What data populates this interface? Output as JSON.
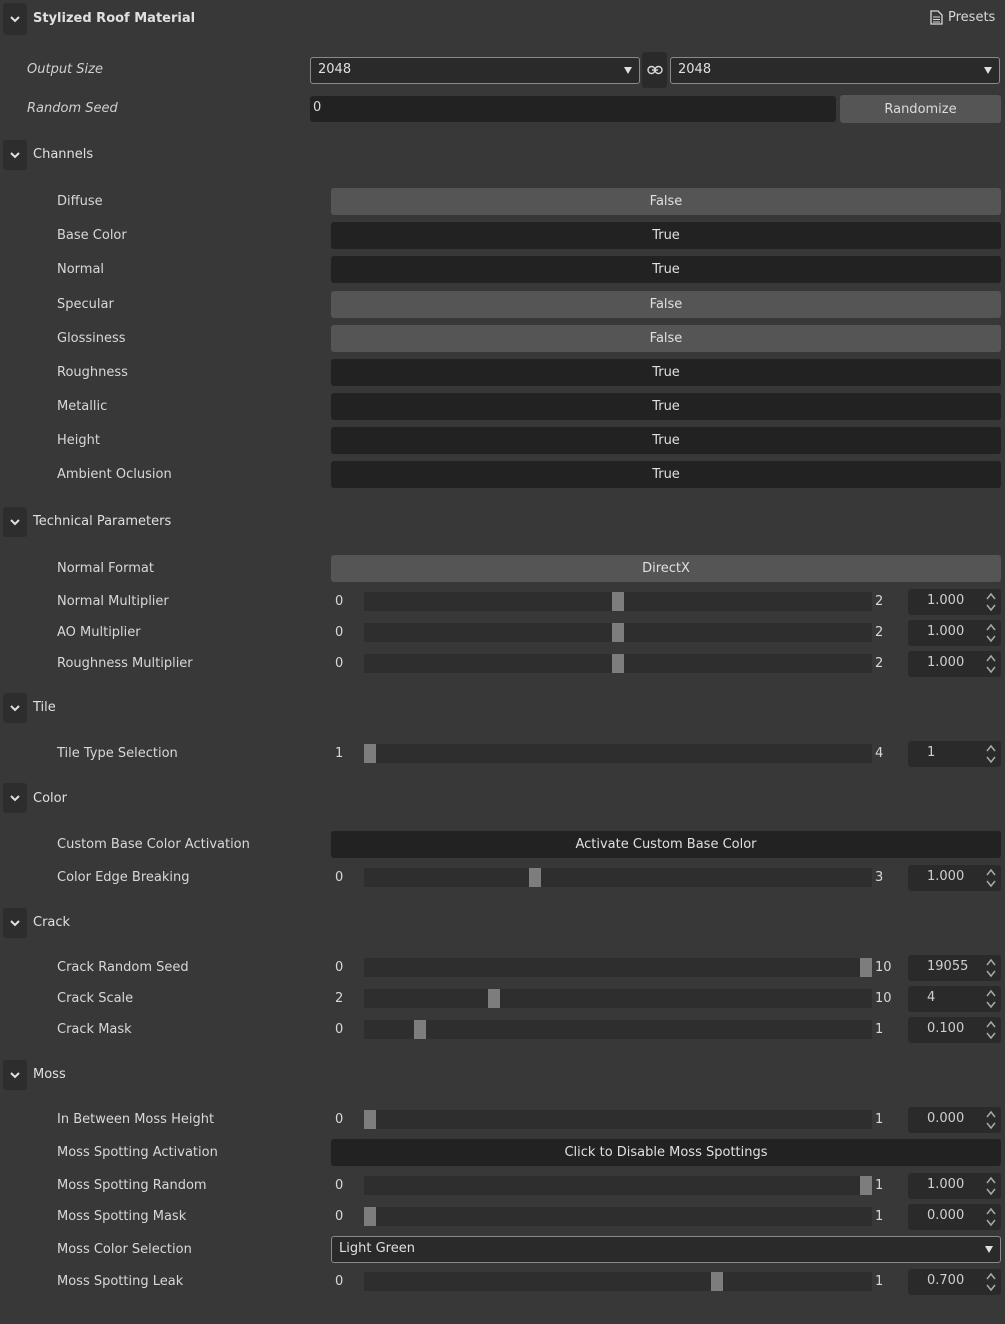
{
  "header": {
    "title": "Stylized Roof Material",
    "presets_label": "Presets"
  },
  "output_size": {
    "label": "Output Size",
    "width": "2048",
    "height": "2048"
  },
  "random_seed": {
    "label": "Random Seed",
    "value": "0",
    "button": "Randomize"
  },
  "channels": {
    "title": "Channels",
    "items": [
      {
        "label": "Diffuse",
        "value": "False"
      },
      {
        "label": "Base Color",
        "value": "True"
      },
      {
        "label": "Normal",
        "value": "True"
      },
      {
        "label": "Specular",
        "value": "False"
      },
      {
        "label": "Glossiness",
        "value": "False"
      },
      {
        "label": "Roughness",
        "value": "True"
      },
      {
        "label": "Metallic",
        "value": "True"
      },
      {
        "label": "Height",
        "value": "True"
      },
      {
        "label": "Ambient Oclusion",
        "value": "True"
      }
    ]
  },
  "technical": {
    "title": "Technical Parameters",
    "normal_format": {
      "label": "Normal Format",
      "value": "DirectX"
    },
    "normal_multiplier": {
      "label": "Normal Multiplier",
      "min": "0",
      "max": "2",
      "value": "1.000",
      "fraction": 0.5
    },
    "ao_multiplier": {
      "label": "AO Multiplier",
      "min": "0",
      "max": "2",
      "value": "1.000",
      "fraction": 0.5
    },
    "roughness_multiplier": {
      "label": "Roughness Multiplier",
      "min": "0",
      "max": "2",
      "value": "1.000",
      "fraction": 0.5
    }
  },
  "tile": {
    "title": "Tile",
    "tile_type": {
      "label": "Tile Type Selection",
      "min": "1",
      "max": "4",
      "value": "1",
      "fraction": 0.0
    }
  },
  "color": {
    "title": "Color",
    "custom_base": {
      "label": "Custom Base Color Activation",
      "button": "Activate Custom Base Color"
    },
    "edge_breaking": {
      "label": "Color Edge Breaking",
      "min": "0",
      "max": "3",
      "value": "1.000",
      "fraction": 0.333
    }
  },
  "crack": {
    "title": "Crack",
    "random_seed": {
      "label": "Crack Random Seed",
      "min": "0",
      "max": "10",
      "value": "19055",
      "fraction": 1.0
    },
    "scale": {
      "label": "Crack Scale",
      "min": "2",
      "max": "10",
      "value": "4",
      "fraction": 0.25
    },
    "mask": {
      "label": "Crack Mask",
      "min": "0",
      "max": "1",
      "value": "0.100",
      "fraction": 0.1
    }
  },
  "moss": {
    "title": "Moss",
    "between_height": {
      "label": "In Between Moss Height",
      "min": "0",
      "max": "1",
      "value": "0.000",
      "fraction": 0.0
    },
    "spotting_activation": {
      "label": "Moss Spotting Activation",
      "button": "Click to Disable Moss Spottings"
    },
    "spotting_random": {
      "label": "Moss Spotting Random",
      "min": "0",
      "max": "1",
      "value": "1.000",
      "fraction": 1.0
    },
    "spotting_mask": {
      "label": "Moss Spotting Mask",
      "min": "0",
      "max": "1",
      "value": "0.000",
      "fraction": 0.0
    },
    "color_selection": {
      "label": "Moss Color Selection",
      "value": "Light Green"
    },
    "spotting_leak": {
      "label": "Moss Spotting Leak",
      "min": "0",
      "max": "1",
      "value": "0.700",
      "fraction": 0.7
    }
  },
  "colors": {
    "false_bg": "#555555",
    "true_bg": "#222222",
    "panel_bg": "#383838",
    "handle": "#7d7d7d"
  }
}
